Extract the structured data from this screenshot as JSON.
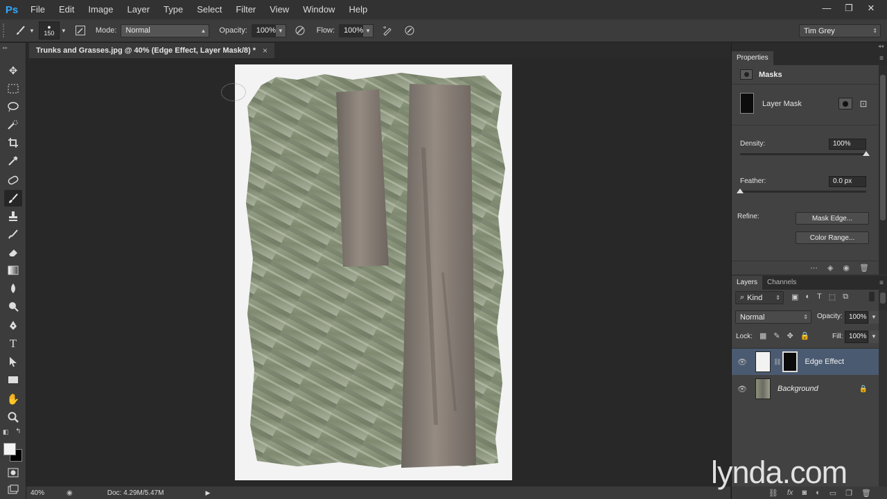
{
  "app": {
    "logo": "Ps"
  },
  "menu": [
    "File",
    "Edit",
    "Image",
    "Layer",
    "Type",
    "Select",
    "Filter",
    "View",
    "Window",
    "Help"
  ],
  "window_controls": {
    "minimize": "—",
    "restore": "❐",
    "close": "✕"
  },
  "options": {
    "brush_size": "150",
    "mode_label": "Mode:",
    "mode_value": "Normal",
    "opacity_label": "Opacity:",
    "opacity_value": "100%",
    "flow_label": "Flow:",
    "flow_value": "100%",
    "workspace": "Tim Grey"
  },
  "document_tab": {
    "title": "Trunks and Grasses.jpg @ 40% (Edge Effect, Layer Mask/8) *",
    "close": "×"
  },
  "status": {
    "zoom": "40%",
    "doc": "Doc: 4.29M/5.47M"
  },
  "properties": {
    "tab": "Properties",
    "section": "Masks",
    "mask_type": "Layer Mask",
    "density_label": "Density:",
    "density_value": "100%",
    "density_level": 1.0,
    "feather_label": "Feather:",
    "feather_value": "0.0 px",
    "feather_level": 0.0,
    "refine_label": "Refine:",
    "mask_edge_button": "Mask Edge...",
    "color_range_button": "Color Range..."
  },
  "layers_panel": {
    "tabs": [
      "Layers",
      "Channels"
    ],
    "kind_filter": "Kind",
    "blend_mode": "Normal",
    "opacity_label": "Opacity:",
    "opacity_value": "100%",
    "lock_label": "Lock:",
    "fill_label": "Fill:",
    "fill_value": "100%",
    "layers": [
      {
        "name": "Edge Effect",
        "selected": true
      },
      {
        "name": "Background",
        "selected": false
      }
    ]
  },
  "watermark": "lynda.com",
  "colors": {
    "accent": "#31a8ff",
    "selected_layer": "#4a5a70",
    "panel": "#424242"
  }
}
